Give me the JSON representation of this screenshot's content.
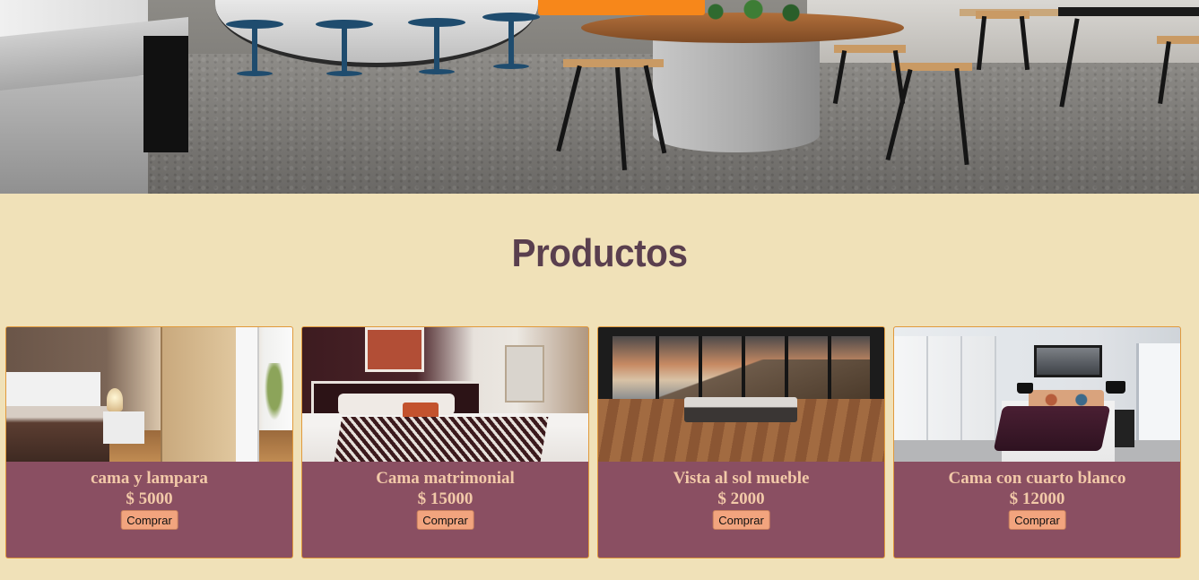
{
  "section": {
    "title": "Productos"
  },
  "products": [
    {
      "name": "cama y lampara",
      "price": "$ 5000",
      "button": "Comprar"
    },
    {
      "name": "Cama matrimonial",
      "price": "$ 15000",
      "button": "Comprar"
    },
    {
      "name": "Vista al sol mueble",
      "price": "$ 2000",
      "button": "Comprar"
    },
    {
      "name": "Cama con cuarto blanco",
      "price": "$ 12000",
      "button": "Comprar"
    }
  ],
  "colors": {
    "page_background": "#f0e1b8",
    "card_background": "#8a4f62",
    "card_border": "#e19a3c",
    "card_text": "#f2c9a8",
    "title": "#5a3f4e",
    "button": "#f2a47e",
    "hero_button": "#f7871a"
  }
}
